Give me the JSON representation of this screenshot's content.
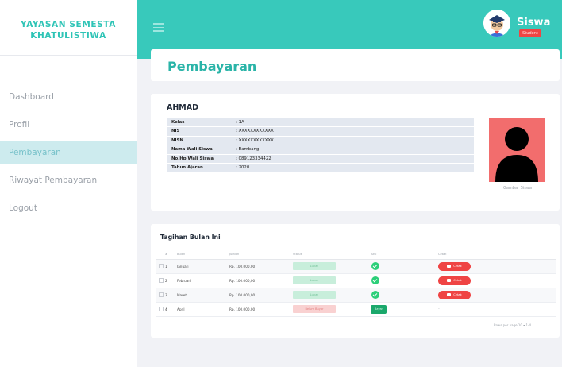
{
  "sidebar": {
    "brand_line1": "YAYASAN SEMESTA",
    "brand_line2": "KHATULISTIWA",
    "items": [
      {
        "label": "Dashboard",
        "active": false
      },
      {
        "label": "Profil",
        "active": false
      },
      {
        "label": "Pembayaran",
        "active": true
      },
      {
        "label": "Riwayat Pembayaran",
        "active": false
      },
      {
        "label": "Logout",
        "active": false
      }
    ]
  },
  "topbar": {
    "menu_icon": "hamburger-icon",
    "avatar_icon": "student-avatar-icon",
    "user_name": "Siswa",
    "user_role": "Student"
  },
  "page": {
    "title": "Pembayaran"
  },
  "student": {
    "name": "AHMAD",
    "fields": [
      {
        "label": "Kelas",
        "value": ": 1A"
      },
      {
        "label": "NIS",
        "value": ": XXXXXXXXXXXX"
      },
      {
        "label": "NISN",
        "value": ": XXXXXXXXXXXX"
      },
      {
        "label": "Nama Wali Siswa",
        "value": ": Bambang"
      },
      {
        "label": "No.Hp Wali Siswa",
        "value": ": 089123334422"
      },
      {
        "label": "Tahun Ajaran",
        "value": ": 2020"
      }
    ],
    "photo_icon": "person-silhouette-icon",
    "photo_caption": "Gambar Siswa"
  },
  "bills": {
    "title": "Tagihan Bulan Ini",
    "headers": [
      "#",
      "Bulan",
      "Jumlah",
      "Status",
      "Aksi",
      "Cetak"
    ],
    "rows": [
      {
        "no": "1",
        "month": "Januari",
        "amount": "Rp. 100.000,00",
        "status": "Lunas",
        "paid": true
      },
      {
        "no": "2",
        "month": "Februari",
        "amount": "Rp. 100.000,00",
        "status": "Lunas",
        "paid": true
      },
      {
        "no": "3",
        "month": "Maret",
        "amount": "Rp. 100.000,00",
        "status": "Lunas",
        "paid": true
      },
      {
        "no": "4",
        "month": "April",
        "amount": "Rp. 100.000,00",
        "status": "Belum Bayar",
        "paid": false
      }
    ],
    "print_label": "Cetak",
    "pay_label": "Bayar",
    "pending_mark": "-",
    "pager_text": "Rows per page 10 ▾   1-4"
  },
  "colors": {
    "accent": "#38c9bb",
    "brand": "#2ec4b6",
    "danger": "#ef4444",
    "success": "#2ccf79"
  }
}
